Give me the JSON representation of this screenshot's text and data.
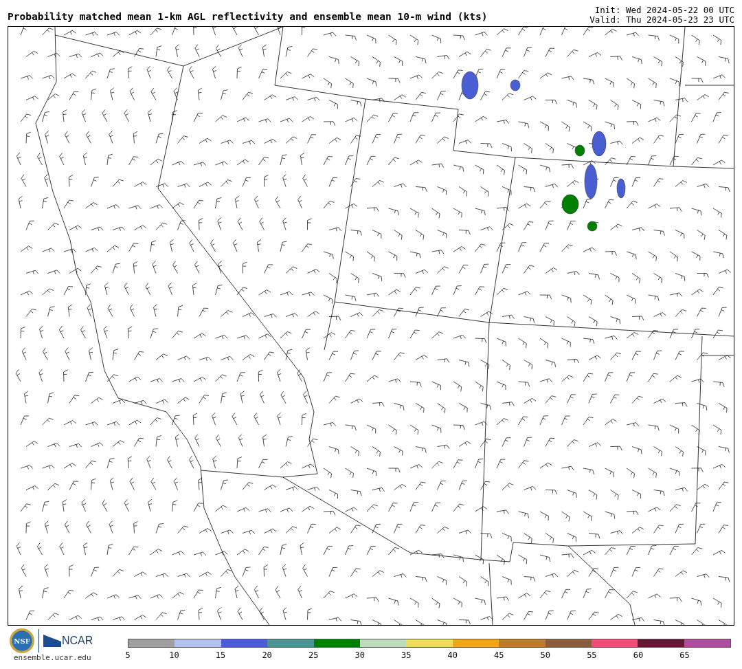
{
  "title": "Probability matched mean 1-km AGL reflectivity and ensemble mean 10-m wind (kts)",
  "init": "Init: Wed 2024-05-22 00 UTC",
  "valid": "Valid: Thu 2024-05-23 23 UTC",
  "logos": {
    "nsf": "NSF",
    "ncar": "NCAR",
    "site": "ensemble.ucar.edu"
  },
  "colorbar": {
    "segments": [
      {
        "color": "#a0a0a0"
      },
      {
        "color": "#b4c0ee"
      },
      {
        "color": "#4a5ed4"
      },
      {
        "color": "#4a9494"
      },
      {
        "color": "#008000"
      },
      {
        "color": "#bcdcbc"
      },
      {
        "color": "#f0dc5c"
      },
      {
        "color": "#f0a818"
      },
      {
        "color": "#bc7c2c"
      },
      {
        "color": "#8c5c3c"
      },
      {
        "color": "#f04c78"
      },
      {
        "color": "#641834"
      },
      {
        "color": "#b04ca0"
      }
    ],
    "ticks": [
      "5",
      "10",
      "15",
      "20",
      "25",
      "30",
      "35",
      "40",
      "45",
      "50",
      "55",
      "60",
      "65"
    ]
  }
}
